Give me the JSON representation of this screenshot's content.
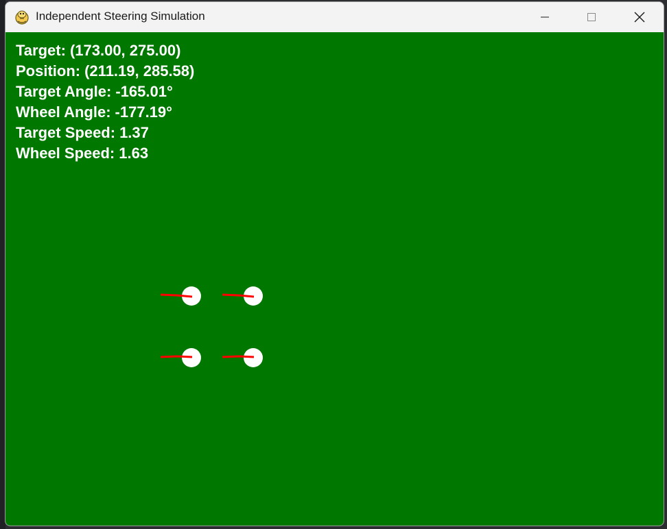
{
  "window": {
    "title": "Independent Steering Simulation",
    "icon": "pygame-snake-icon"
  },
  "controls": {
    "minimize_icon": "minimize-icon",
    "maximize_icon": "maximize-icon",
    "close_icon": "close-icon"
  },
  "canvas": {
    "background": "#007800"
  },
  "hud": {
    "target_label": "Target:",
    "target_value": "(173.00, 275.00)",
    "position_label": "Position:",
    "position_value": "(211.19, 285.58)",
    "target_angle_label": "Target Angle:",
    "target_angle_value": "-165.01°",
    "wheel_angle_label": "Wheel Angle:",
    "wheel_angle_value": "-177.19°",
    "target_speed_label": "Target Speed:",
    "target_speed_value": "1.37",
    "wheel_speed_label": "Wheel Speed:",
    "wheel_speed_value": "1.63"
  },
  "wheels": {
    "count": 4,
    "wheel_color": "#ffffff",
    "indicator_color": "#ff0000"
  }
}
